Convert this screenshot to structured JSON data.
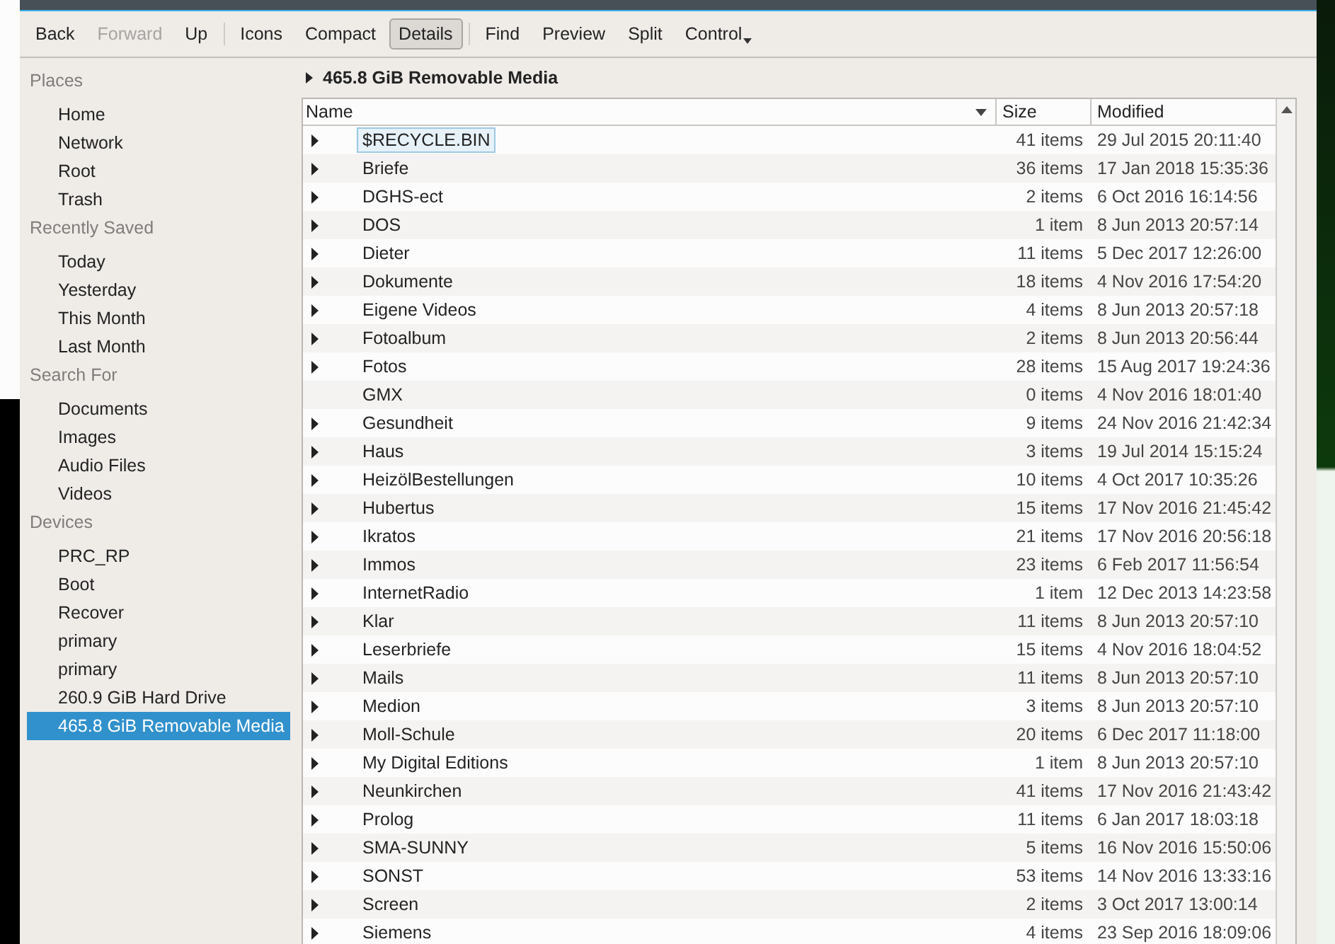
{
  "toolbar": [
    {
      "label": "Back",
      "disabled": false,
      "selected": false,
      "kind": "button"
    },
    {
      "label": "Forward",
      "disabled": true,
      "selected": false,
      "kind": "button"
    },
    {
      "label": "Up",
      "disabled": false,
      "selected": false,
      "kind": "button"
    },
    {
      "kind": "separator"
    },
    {
      "label": "Icons",
      "disabled": false,
      "selected": false,
      "kind": "button"
    },
    {
      "label": "Compact",
      "disabled": false,
      "selected": false,
      "kind": "button"
    },
    {
      "label": "Details",
      "disabled": false,
      "selected": true,
      "kind": "button"
    },
    {
      "kind": "separator"
    },
    {
      "label": "Find",
      "disabled": false,
      "selected": false,
      "kind": "button"
    },
    {
      "label": "Preview",
      "disabled": false,
      "selected": false,
      "kind": "button"
    },
    {
      "label": "Split",
      "disabled": false,
      "selected": false,
      "kind": "button"
    },
    {
      "label": "Control",
      "disabled": false,
      "selected": false,
      "kind": "menu"
    }
  ],
  "sidebar": [
    {
      "heading": "Places",
      "items": [
        {
          "label": "Home",
          "selected": false
        },
        {
          "label": "Network",
          "selected": false
        },
        {
          "label": "Root",
          "selected": false
        },
        {
          "label": "Trash",
          "selected": false
        }
      ]
    },
    {
      "heading": "Recently Saved",
      "items": [
        {
          "label": "Today",
          "selected": false
        },
        {
          "label": "Yesterday",
          "selected": false
        },
        {
          "label": "This Month",
          "selected": false
        },
        {
          "label": "Last Month",
          "selected": false
        }
      ]
    },
    {
      "heading": "Search For",
      "items": [
        {
          "label": "Documents",
          "selected": false
        },
        {
          "label": "Images",
          "selected": false
        },
        {
          "label": "Audio Files",
          "selected": false
        },
        {
          "label": "Videos",
          "selected": false
        }
      ]
    },
    {
      "heading": "Devices",
      "items": [
        {
          "label": "PRC_RP",
          "selected": false
        },
        {
          "label": "Boot",
          "selected": false
        },
        {
          "label": "Recover",
          "selected": false
        },
        {
          "label": "primary",
          "selected": false
        },
        {
          "label": "primary",
          "selected": false
        },
        {
          "label": "260.9 GiB Hard Drive",
          "selected": false
        },
        {
          "label": "465.8 GiB Removable Media",
          "selected": true
        }
      ]
    }
  ],
  "breadcrumb": "465.8 GiB Removable Media",
  "table": {
    "columns": [
      "Name",
      "Size",
      "Modified"
    ],
    "rows": [
      {
        "name": "$RECYCLE.BIN",
        "size": "41 items",
        "modified": "29 Jul 2015 20:11:40",
        "expandable": true,
        "selected": true
      },
      {
        "name": "Briefe",
        "size": "36 items",
        "modified": "17 Jan 2018 15:35:36",
        "expandable": true,
        "selected": false
      },
      {
        "name": "DGHS-ect",
        "size": "2 items",
        "modified": "6 Oct 2016 16:14:56",
        "expandable": true,
        "selected": false
      },
      {
        "name": "DOS",
        "size": "1 item",
        "modified": "8 Jun 2013 20:57:14",
        "expandable": true,
        "selected": false
      },
      {
        "name": "Dieter",
        "size": "11 items",
        "modified": "5 Dec 2017 12:26:00",
        "expandable": true,
        "selected": false
      },
      {
        "name": "Dokumente",
        "size": "18 items",
        "modified": "4 Nov 2016 17:54:20",
        "expandable": true,
        "selected": false
      },
      {
        "name": "Eigene Videos",
        "size": "4 items",
        "modified": "8 Jun 2013 20:57:18",
        "expandable": true,
        "selected": false
      },
      {
        "name": "Fotoalbum",
        "size": "2 items",
        "modified": "8 Jun 2013 20:56:44",
        "expandable": true,
        "selected": false
      },
      {
        "name": "Fotos",
        "size": "28 items",
        "modified": "15 Aug 2017 19:24:36",
        "expandable": true,
        "selected": false
      },
      {
        "name": "GMX",
        "size": "0 items",
        "modified": "4 Nov 2016 18:01:40",
        "expandable": false,
        "selected": false
      },
      {
        "name": "Gesundheit",
        "size": "9 items",
        "modified": "24 Nov 2016 21:42:34",
        "expandable": true,
        "selected": false
      },
      {
        "name": "Haus",
        "size": "3 items",
        "modified": "19 Jul 2014 15:15:24",
        "expandable": true,
        "selected": false
      },
      {
        "name": "HeizölBestellungen",
        "size": "10 items",
        "modified": "4 Oct 2017 10:35:26",
        "expandable": true,
        "selected": false
      },
      {
        "name": "Hubertus",
        "size": "15 items",
        "modified": "17 Nov 2016 21:45:42",
        "expandable": true,
        "selected": false
      },
      {
        "name": "Ikratos",
        "size": "21 items",
        "modified": "17 Nov 2016 20:56:18",
        "expandable": true,
        "selected": false
      },
      {
        "name": "Immos",
        "size": "23 items",
        "modified": "6 Feb 2017 11:56:54",
        "expandable": true,
        "selected": false
      },
      {
        "name": "InternetRadio",
        "size": "1 item",
        "modified": "12 Dec 2013 14:23:58",
        "expandable": true,
        "selected": false
      },
      {
        "name": "Klar",
        "size": "11 items",
        "modified": "8 Jun 2013 20:57:10",
        "expandable": true,
        "selected": false
      },
      {
        "name": "Leserbriefe",
        "size": "15 items",
        "modified": "4 Nov 2016 18:04:52",
        "expandable": true,
        "selected": false
      },
      {
        "name": "Mails",
        "size": "11 items",
        "modified": "8 Jun 2013 20:57:10",
        "expandable": true,
        "selected": false
      },
      {
        "name": "Medion",
        "size": "3 items",
        "modified": "8 Jun 2013 20:57:10",
        "expandable": true,
        "selected": false
      },
      {
        "name": "Moll-Schule",
        "size": "20 items",
        "modified": "6 Dec 2017 11:18:00",
        "expandable": true,
        "selected": false
      },
      {
        "name": "My Digital Editions",
        "size": "1 item",
        "modified": "8 Jun 2013 20:57:10",
        "expandable": true,
        "selected": false
      },
      {
        "name": "Neunkirchen",
        "size": "41 items",
        "modified": "17 Nov 2016 21:43:42",
        "expandable": true,
        "selected": false
      },
      {
        "name": "Prolog",
        "size": "11 items",
        "modified": "6 Jan 2017 18:03:18",
        "expandable": true,
        "selected": false
      },
      {
        "name": "SMA-SUNNY",
        "size": "5 items",
        "modified": "16 Nov 2016 15:50:06",
        "expandable": true,
        "selected": false
      },
      {
        "name": "SONST",
        "size": "53 items",
        "modified": "14 Nov 2016 13:33:16",
        "expandable": true,
        "selected": false
      },
      {
        "name": "Screen",
        "size": "2 items",
        "modified": "3 Oct 2017 13:00:14",
        "expandable": true,
        "selected": false
      },
      {
        "name": "Siemens",
        "size": "4 items",
        "modified": "23 Sep 2016 18:09:06",
        "expandable": true,
        "selected": false
      }
    ]
  }
}
